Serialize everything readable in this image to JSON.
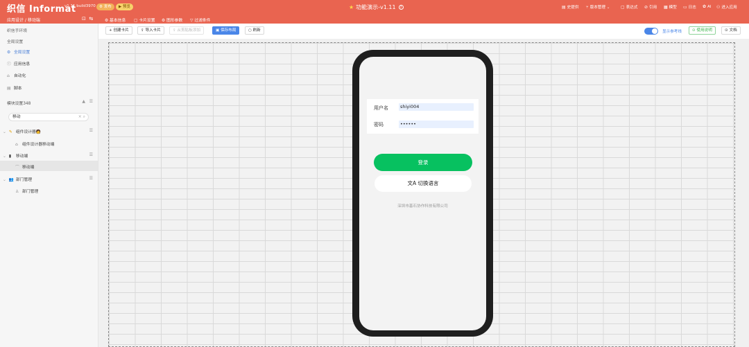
{
  "header": {
    "logo": "织信 Informat",
    "version": "v1.11 build3970",
    "publish_label": "发布",
    "preview_label": "预览",
    "project_title": "功能演示-v1.11",
    "nav": [
      {
        "icon": "history-icon",
        "label": "史提供"
      },
      {
        "icon": "version-icon",
        "label": "版本管理"
      },
      {
        "icon": "expression-icon",
        "label": "表达式"
      },
      {
        "icon": "reference-icon",
        "label": "引用"
      },
      {
        "icon": "template-icon",
        "label": "模型"
      },
      {
        "icon": "log-icon",
        "label": "日志"
      },
      {
        "icon": "ai-icon",
        "label": "AI"
      },
      {
        "icon": "enter-app-icon",
        "label": "进入应用"
      }
    ]
  },
  "subbar": {
    "breadcrumb": "应用设计 / 移动端",
    "tabs": [
      {
        "icon": "gear-icon",
        "label": "基本信息"
      },
      {
        "icon": "card-icon",
        "label": "卡片设置"
      },
      {
        "icon": "param-icon",
        "label": "图形参数"
      },
      {
        "icon": "filter-icon",
        "label": "过滤条件"
      }
    ]
  },
  "sidebar": {
    "env": "织信手环境",
    "global_title": "全局设置",
    "global_items": [
      {
        "icon": "settings-icon",
        "label": "全局设置",
        "active": true
      },
      {
        "icon": "info-icon",
        "label": "应用信息",
        "active": false
      },
      {
        "icon": "automation-icon",
        "label": "自动化",
        "active": false
      },
      {
        "icon": "script-icon",
        "label": "脚本",
        "active": false
      }
    ],
    "module_title": "模块设置348",
    "search_value": "移动",
    "tree": [
      {
        "icon": "component-icon",
        "label": "组件设计器🧑",
        "level": 0
      },
      {
        "icon": "home-icon",
        "label": "组件设计器移动端",
        "level": 1
      },
      {
        "icon": "phone-icon",
        "label": "移动端",
        "level": 0
      },
      {
        "icon": "chart-icon",
        "label": "移动端",
        "level": 1
      },
      {
        "icon": "group-icon",
        "label": "部门管理",
        "level": 0
      },
      {
        "icon": "user-icon",
        "label": "部门管理",
        "level": 1
      }
    ]
  },
  "toolbar": {
    "create_card": "+ 创建卡片",
    "import_card": "导入卡片",
    "paste_card": "从剪贴板添加",
    "save_layout": "保存布局",
    "refresh": "刷新",
    "show_guides": "显示参考线",
    "use_guide": "使用说明",
    "docs": "文档"
  },
  "login": {
    "username_label": "用户名",
    "username_value": "shiyi004",
    "password_label": "密码",
    "password_value": "••••••",
    "login_button": "登录",
    "lang_button": "切换语言",
    "company": "深圳市基石协作科技有限公司"
  },
  "colors": {
    "header": "#e96450",
    "accent": "#4a86e8",
    "login": "#07c160"
  }
}
